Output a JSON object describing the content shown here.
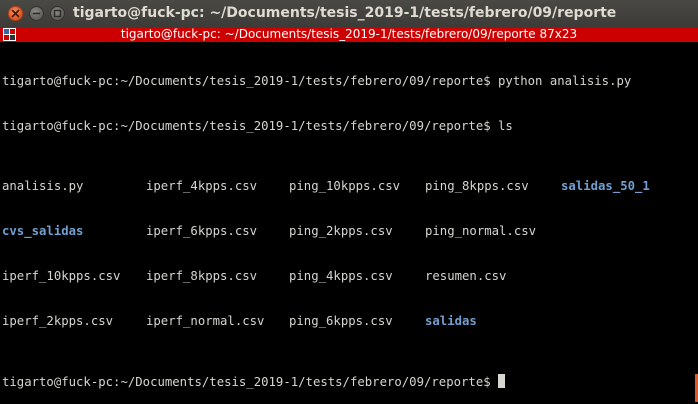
{
  "window": {
    "title": "tigarto@fuck-pc: ~/Documents/tesis_2019-1/tests/febrero/09/reporte",
    "tab_title": "tigarto@fuck-pc: ~/Documents/tesis_2019-1/tests/febrero/09/reporte 87x23"
  },
  "terminal": {
    "lines": [
      "tigarto@fuck-pc:~/Documents/tesis_2019-1/tests/febrero/09/reporte$ python analisis.py",
      "tigarto@fuck-pc:~/Documents/tesis_2019-1/tests/febrero/09/reporte$ ls"
    ],
    "ls_rows": [
      [
        "analisis.py",
        "iperf_4kpps.csv",
        "ping_10kpps.csv",
        "ping_8kpps.csv",
        "salidas_50_1"
      ],
      [
        "cvs_salidas",
        "iperf_6kpps.csv",
        "ping_2kpps.csv",
        "ping_normal.csv",
        ""
      ],
      [
        "iperf_10kpps.csv",
        "iperf_8kpps.csv",
        "ping_4kpps.csv",
        "resumen.csv",
        ""
      ],
      [
        "iperf_2kpps.csv",
        "iperf_normal.csv",
        "ping_6kpps.csv",
        "salidas",
        ""
      ]
    ],
    "prompt": "tigarto@fuck-pc:~/Documents/tesis_2019-1/tests/febrero/09/reporte$"
  },
  "colors": {
    "background": "#000000",
    "foreground": "#d3d7cf",
    "directory": "#729fcf",
    "tabbar": "#cc0000",
    "titlebar": "#3c3b37"
  }
}
